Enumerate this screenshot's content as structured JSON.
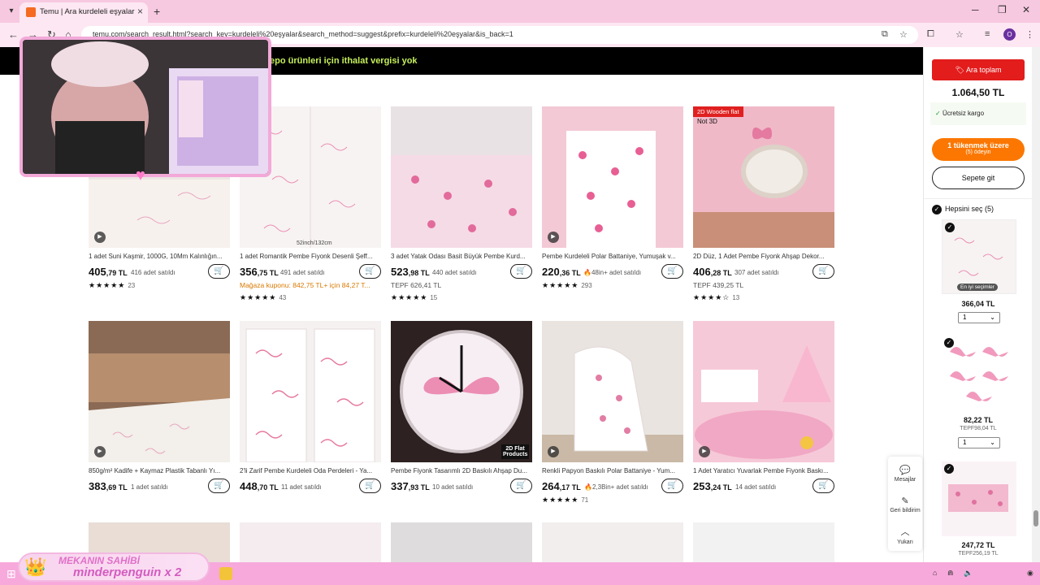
{
  "browser": {
    "tab_title": "Temu | Ara kurdeleli eşyalar",
    "url": "temu.com/search_result.html?search_key=kurdeleli%20eşyalar&search_method=suggest&prefix=kurdeleli%20eşyalar&is_back=1",
    "profile_initial": "O"
  },
  "banner": {
    "text": "epo ürünleri için ithalat vergisi yok"
  },
  "row1": [
    {
      "name": "1 adet Suni Kaşmir, 1000G, 10Mm Kalınlığın...",
      "price_int": "405",
      "price_dec": ",79 TL",
      "sold": "416 adet satıldı",
      "line2": "",
      "stars": "★★★★★",
      "rating_count": "23"
    },
    {
      "name": "1 adet Romantik Pembe Fiyonk Desenli Şeff...",
      "price_int": "356",
      "price_dec": ",75 TL",
      "sold": "491 adet satıldı",
      "line2": "Mağaza kuponu: 842,75 TL+ için 84,27 T...",
      "stars": "★★★★★",
      "rating_count": "43"
    },
    {
      "name": "3 adet Yatak Odası Basit Büyük Pembe Kurd...",
      "price_int": "523",
      "price_dec": ",98 TL",
      "sold": "440 adet satıldı",
      "line2": "TEPF 626,41 TL",
      "stars": "★★★★★",
      "rating_count": "15"
    },
    {
      "name": "Pembe Kurdeleli Polar Battaniye, Yumuşak v...",
      "price_int": "220",
      "price_dec": ",36 TL",
      "sold": "🔥48in+ adet satıldı",
      "line2": "",
      "stars": "★★★★★",
      "rating_count": "293"
    },
    {
      "name": "2D Düz, 1 Adet Pembe Fiyonk Ahşap Dekor...",
      "price_int": "406",
      "price_dec": ",28 TL",
      "sold": "307 adet satıldı",
      "line2": "TEPF 439,25 TL",
      "stars": "★★★★☆",
      "rating_count": "13",
      "badge": "2D Wooden flat",
      "badge2": "Not 3D"
    }
  ],
  "row2": [
    {
      "name": "850g/m² Kadife + Kaymaz Plastik Tabanlı Yı...",
      "price_int": "383",
      "price_dec": ",69 TL",
      "sold": "1 adet satıldı",
      "stars": "",
      "rating_count": ""
    },
    {
      "name": "2'li Zarif Pembe Kurdeleli Oda Perdeleri - Ya...",
      "price_int": "448",
      "price_dec": ",70 TL",
      "sold": "11 adet satıldı",
      "stars": "",
      "rating_count": ""
    },
    {
      "name": "Pembe Fiyonk Tasarımlı 2D Baskılı Ahşap Du...",
      "price_int": "337",
      "price_dec": ",93 TL",
      "sold": "10 adet satıldı",
      "stars": "",
      "rating_count": "",
      "badge": "2D Flat Products"
    },
    {
      "name": "Renkli Papyon Baskılı Polar Battaniye - Yum...",
      "price_int": "264",
      "price_dec": ",17 TL",
      "sold": "🔥2,3Bin+ adet satıldı",
      "stars": "★★★★★",
      "rating_count": "71"
    },
    {
      "name": "1 Adet Yaratıcı Yuvarlak Pembe Fiyonk Baskı...",
      "price_int": "253",
      "price_dec": ",24 TL",
      "sold": "14 adet satıldı",
      "stars": "",
      "rating_count": ""
    }
  ],
  "sidebar": {
    "subtotal_label": "Ara toplam",
    "subtotal_value": "1.064,50 TL",
    "free_shipping": "Ücretsiz kargo",
    "checkout_label": "1 tükenmek üzere",
    "checkout_sub": "(5) ödeyin",
    "cart_label": "Sepete git",
    "select_all": "Hepsini seç (5)",
    "items": [
      {
        "price": "366,04 TL",
        "qty": "1",
        "badge": "En iyi seçimler"
      },
      {
        "price": "82,22 TL",
        "tepf": "TEPF98,04 TL",
        "qty": "1"
      },
      {
        "price": "247,72 TL",
        "tepf": "TEPF256,19 TL"
      }
    ]
  },
  "float": {
    "messages": "Mesajlar",
    "feedback": "Geri bildirim",
    "top": "Yukarı"
  },
  "overlay": {
    "line1": "MEKANIN SAHİBİ",
    "line2": "minderpenguin x 2"
  },
  "colors": {
    "accent": "#fb7701",
    "red": "#e02020",
    "pink": "#f7c9e1"
  }
}
